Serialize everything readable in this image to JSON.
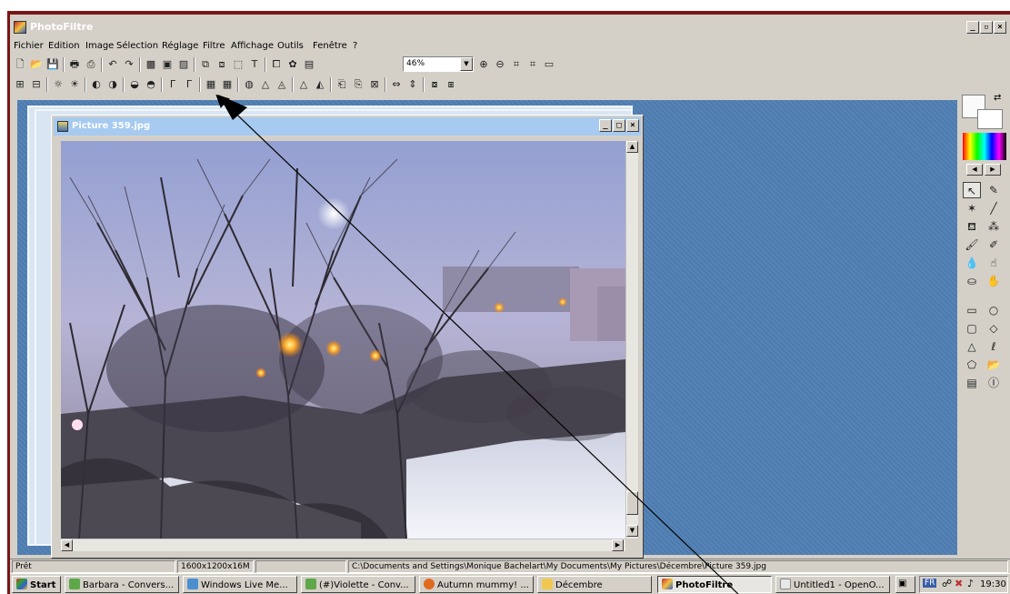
{
  "app": {
    "title": "PhotoFiltre"
  },
  "menu": {
    "items": [
      "Fichier",
      "Edition",
      "Image",
      "Sélection",
      "Réglage",
      "Filtre",
      "Affichage",
      "Outils",
      "Fenêtre",
      "?"
    ]
  },
  "toolbar": {
    "zoom_value": "46%"
  },
  "document": {
    "title": "Picture 359.jpg"
  },
  "status": {
    "state": "Prêt",
    "dimensions": "1600x1200x16M",
    "path": "C:\\Documents and Settings\\Monique Bachelart\\My Documents\\My Pictures\\Décembre\\Picture 359.jpg"
  },
  "taskbar": {
    "start_label": "Start",
    "tasks": [
      "Barbara - Convers...",
      "Windows Live Me...",
      "(#)Violette - Conv...",
      "Autumn mummy! ...",
      "Décembre",
      "PhotoFiltre",
      "Untitled1 - OpenO..."
    ],
    "language": "FR",
    "clock": "19:30"
  },
  "colors": {
    "frame_border": "#7a1515",
    "workspace": "#4f7fb3",
    "window_face": "#d4d0c8",
    "inactive_title": "#a6caf0",
    "arrow": "#000000"
  }
}
